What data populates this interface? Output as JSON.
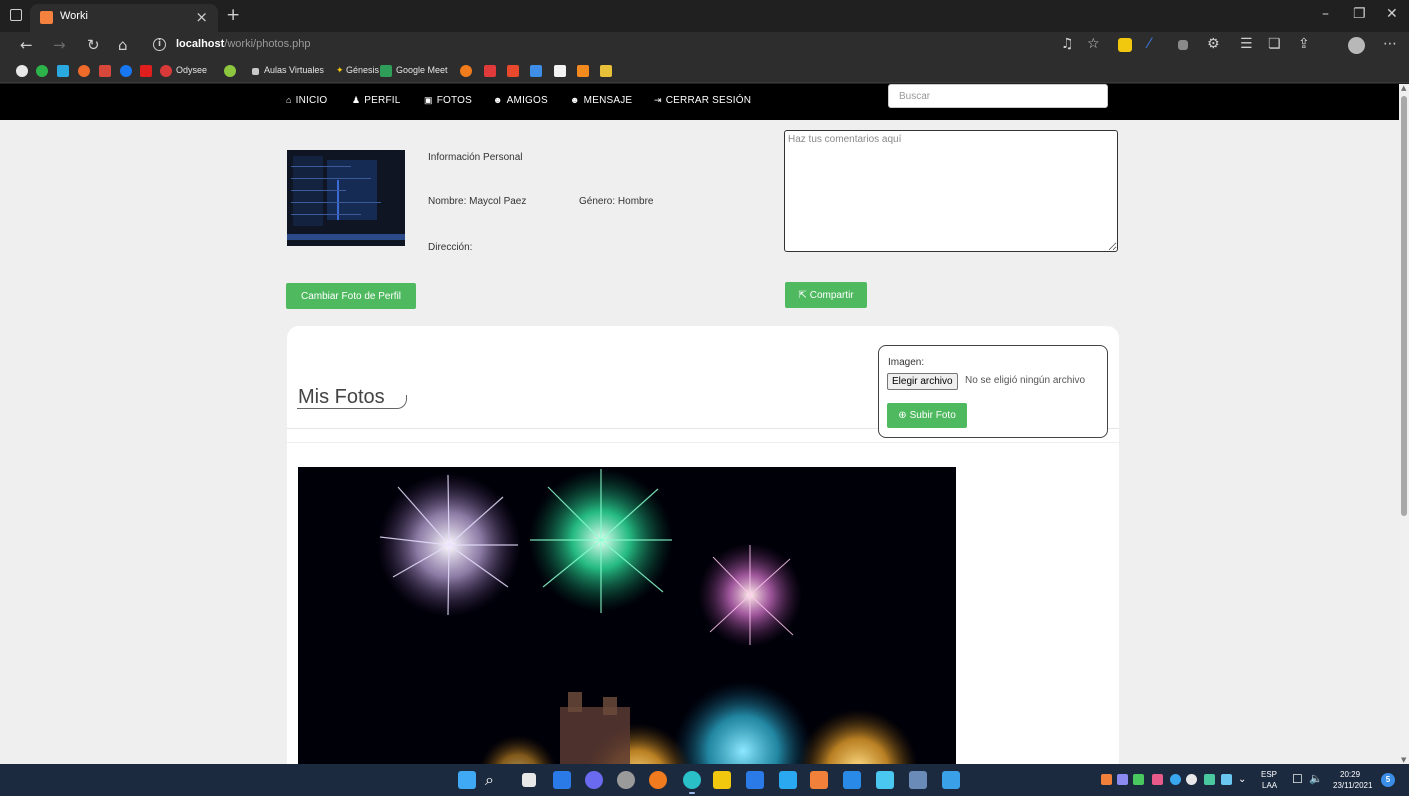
{
  "browser": {
    "tab_title": "Worki",
    "tab_close": "×",
    "new_tab": "+",
    "window_controls": [
      "–",
      "❐",
      "✕"
    ],
    "url_host": "localhost",
    "url_path": "/worki/photos.php",
    "bookmarks": [
      "Odysee",
      "Aulas Virtuales",
      "Génesis",
      "Google Meet"
    ]
  },
  "site_nav": {
    "items": [
      {
        "icon": "home-icon",
        "glyph": "⌂",
        "label": "INICIO"
      },
      {
        "icon": "user-icon",
        "glyph": "♟",
        "label": "PERFIL"
      },
      {
        "icon": "picture-icon",
        "glyph": "▣",
        "label": "FOTOS"
      },
      {
        "icon": "users-icon",
        "glyph": "☻",
        "label": "AMIGOS"
      },
      {
        "icon": "message-icon",
        "glyph": "☻",
        "label": "MENSAJE"
      },
      {
        "icon": "logout-icon",
        "glyph": "⇥",
        "label": "CERRAR SESIÓN"
      }
    ],
    "search_placeholder": "Buscar"
  },
  "profile": {
    "section_title": "Información Personal",
    "name": "Nombre: Maycol Paez",
    "gender": "Género: Hombre",
    "address": "Dirección:",
    "change_photo_label": "Cambiar Foto de Perfil"
  },
  "comment": {
    "placeholder": "Haz tus comentarios aquí",
    "share_label": "Compartir",
    "share_icon": "share-icon"
  },
  "photos": {
    "title": "Mis Fotos",
    "upload_label": "Imagen:",
    "choose_file_label": "Elegir archivo",
    "no_file_text": "No se eligió ningún archivo",
    "upload_button_label": "Subir Foto",
    "upload_icon": "upload-icon"
  },
  "taskbar": {
    "lang_top": "ESP",
    "lang_bottom": "LAA",
    "time": "20:29",
    "date": "23/11/2021",
    "notification_count": "5"
  },
  "colors": {
    "accent_green": "#4fb960",
    "nav_bg": "#000000",
    "page_bg": "#efefef",
    "taskbar_bg": "#1c2a3f"
  }
}
